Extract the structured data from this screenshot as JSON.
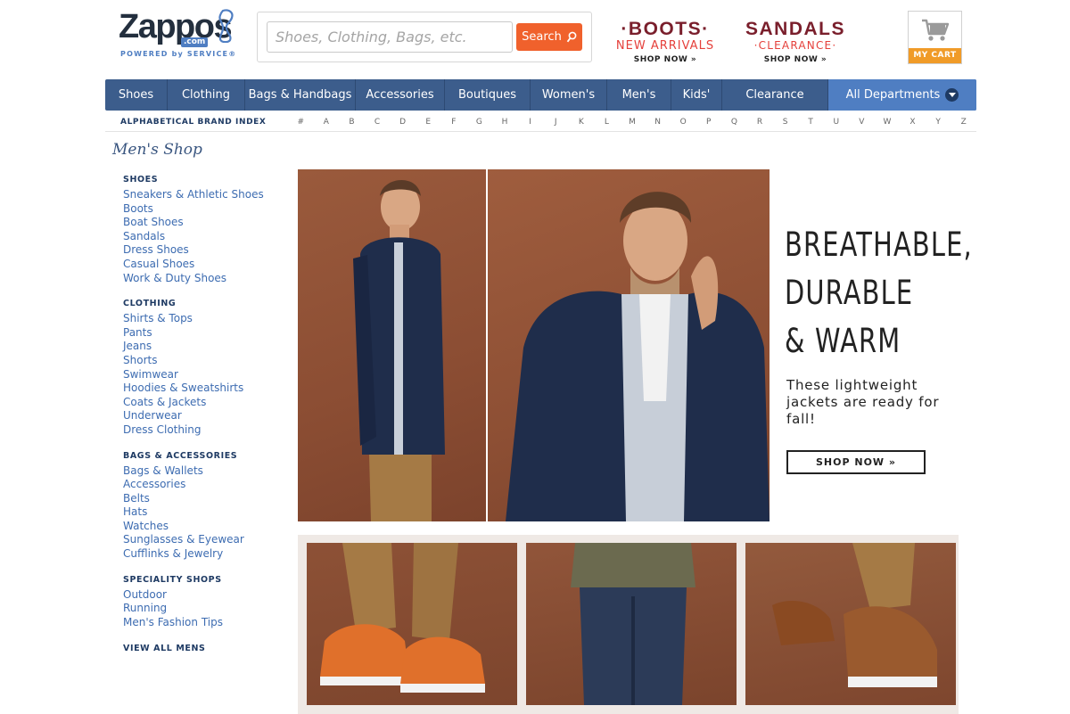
{
  "brand": {
    "name": "Zappos",
    "suffix": ".com",
    "tagline": "POWERED by SERVICE®"
  },
  "search": {
    "placeholder": "Shoes, Clothing, Bags, etc.",
    "button_label": "Search"
  },
  "promos": [
    {
      "title": "·BOOTS·",
      "subtitle": "NEW ARRIVALS",
      "cta": "SHOP NOW »"
    },
    {
      "title": "SANDALS",
      "subtitle": "·CLEARANCE·",
      "cta": "SHOP NOW »"
    }
  ],
  "cart": {
    "label": "MY CART"
  },
  "nav": {
    "items": [
      "Shoes",
      "Clothing",
      "Bags & Handbags",
      "Accessories",
      "Boutiques",
      "Women's",
      "Men's",
      "Kids'",
      "Clearance"
    ],
    "all_departments": "All Departments"
  },
  "brand_index": {
    "title": "ALPHABETICAL BRAND INDEX",
    "letters": [
      "#",
      "A",
      "B",
      "C",
      "D",
      "E",
      "F",
      "G",
      "H",
      "I",
      "J",
      "K",
      "L",
      "M",
      "N",
      "O",
      "P",
      "Q",
      "R",
      "S",
      "T",
      "U",
      "V",
      "W",
      "X",
      "Y",
      "Z"
    ]
  },
  "sidebar": {
    "title": "Men's Shop",
    "sections": [
      {
        "heading": "SHOES",
        "links": [
          "Sneakers & Athletic Shoes",
          "Boots",
          "Boat Shoes",
          "Sandals",
          "Dress Shoes",
          "Casual Shoes",
          "Work & Duty Shoes"
        ]
      },
      {
        "heading": "CLOTHING",
        "links": [
          "Shirts & Tops",
          "Pants",
          "Jeans",
          "Shorts",
          "Swimwear",
          "Hoodies & Sweatshirts",
          "Coats & Jackets",
          "Underwear",
          "Dress Clothing"
        ]
      },
      {
        "heading": "BAGS & ACCESSORIES",
        "links": [
          "Bags & Wallets",
          "Accessories",
          "Belts",
          "Hats",
          "Watches",
          "Sunglasses & Eyewear",
          "Cufflinks & Jewelry"
        ]
      },
      {
        "heading": "SPECIALITY SHOPS",
        "links": [
          "Outdoor",
          "Running",
          "Men's Fashion Tips"
        ]
      }
    ],
    "view_all": "VIEW ALL MENS"
  },
  "hero": {
    "headline_lines": [
      "BREATHABLE,",
      "DURABLE",
      "& WARM"
    ],
    "tagline": "These lightweight jackets are ready for fall!",
    "cta": "SHOP NOW »"
  },
  "colors": {
    "nav_bg": "#3c5d8c",
    "nav_accent": "#4f7ec2",
    "search_button": "#f0612c",
    "cart_accent": "#f09b28",
    "link": "#3d6cb1",
    "promo_title": "#7a1f2c",
    "promo_sub": "#e5403b"
  }
}
